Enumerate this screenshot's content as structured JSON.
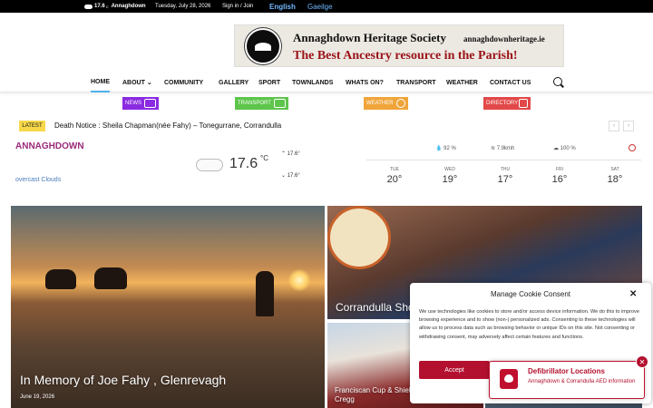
{
  "topbar": {
    "weather_temp": "17.6",
    "weather_unit": "C",
    "location": "Annaghdown",
    "date": "Tuesday, July 28, 2026",
    "signin": "Sign in / Join",
    "lang_en": "English",
    "lang_ga": "Gaeilge"
  },
  "banner": {
    "title": "Annaghdown Heritage Society",
    "url": "annaghdownheritage.ie",
    "tagline": "The Best Ancestry resource in the Parish!"
  },
  "nav": {
    "items": [
      "HOME",
      "ABOUT",
      "COMMUNITY",
      "GALLERY",
      "SPORT",
      "TOWNLANDS",
      "WHATS ON?",
      "TRANSPORT",
      "WEATHER",
      "CONTACT US"
    ],
    "about_caret": "⌄"
  },
  "categories": [
    {
      "label": "NEWS",
      "color": "#8a2be2"
    },
    {
      "label": "TRANSPORT",
      "color": "#5dc54b"
    },
    {
      "label": "WEATHER",
      "color": "#f0a53a"
    },
    {
      "label": "DIRECTORY",
      "color": "#e24848"
    }
  ],
  "ticker": {
    "badge": "LATEST",
    "headline": "Death Notice : Sheila Chapman(née Fahy) – Tonegurrane, Corrandulla",
    "prev": "‹",
    "next": "›"
  },
  "weather": {
    "location": "ANNAGHDOWN",
    "description": "overcast Clouds",
    "temp": "17.6",
    "unit": "°C",
    "high": "17.6°",
    "low": "17.6°",
    "humidity": "92 %",
    "wind": "7.9kmh",
    "clouds": "100 %",
    "forecast": [
      {
        "day": "TUE",
        "temp": "20°"
      },
      {
        "day": "WED",
        "temp": "19°"
      },
      {
        "day": "THU",
        "temp": "17°"
      },
      {
        "day": "FRI",
        "temp": "16°"
      },
      {
        "day": "SAT",
        "temp": "18°"
      }
    ]
  },
  "posts": [
    {
      "title": "In Memory of Joe Fahy , Glenrevagh",
      "date": "June 19, 2026"
    },
    {
      "title": "Corrandulla Sho"
    },
    {
      "title_line1": "Franciscan Cup & Shiel",
      "title_line2": "Cregg"
    }
  ],
  "cookie": {
    "title": "Manage Cookie Consent",
    "close": "✕",
    "body": "We use technologies like cookies to store and/or access device information. We do this to improve browsing experience and to show (non-) personalized ads. Consenting to these technologies will allow us to process data such as browsing behavior or unique IDs on this site. Not consenting or withdrawing consent, may adversely affect certain features and functions.",
    "accept": "Accept"
  },
  "defib": {
    "title": "Defibrillator Locations",
    "subtitle": "Annaghdown & Corrandulla AED information",
    "close": "✕"
  }
}
